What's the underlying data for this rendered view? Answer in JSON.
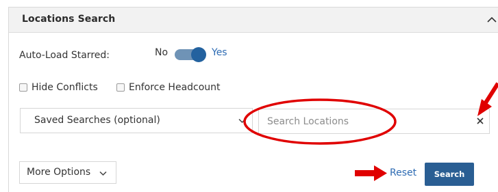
{
  "panel": {
    "title": "Locations Search",
    "collapse_icon": "chevron-up-icon"
  },
  "autoload": {
    "label": "Auto-Load Starred:",
    "off_label": "No",
    "on_label": "Yes",
    "state": "on"
  },
  "filters": {
    "hide_conflicts": "Hide Conflicts",
    "enforce_headcount": "Enforce Headcount"
  },
  "saved_searches": {
    "label": "Saved Searches (optional)"
  },
  "search": {
    "placeholder": "Search Locations",
    "value": "",
    "clear_icon": "close-icon"
  },
  "actions": {
    "more_options": "More Options",
    "reset": "Reset",
    "search": "Search"
  },
  "colors": {
    "accent": "#2d6bb3",
    "button": "#2a5e93",
    "annotation": "#e00000"
  }
}
